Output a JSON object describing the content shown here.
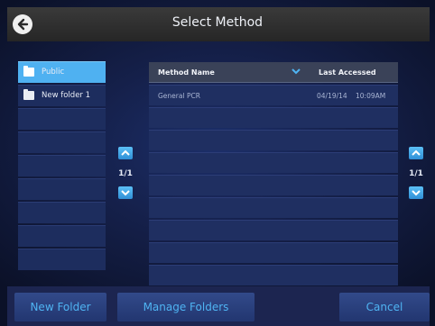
{
  "header": {
    "title": "Select Method"
  },
  "folders": [
    {
      "label": "Public",
      "selected": true
    },
    {
      "label": "New folder 1",
      "selected": false
    }
  ],
  "folder_pager": {
    "page_text": "1/1"
  },
  "method_pager": {
    "page_text": "1/1"
  },
  "table": {
    "columns": [
      "Method Name",
      "Last Accessed"
    ],
    "rows": [
      {
        "name": "General PCR",
        "date": "04/19/14",
        "time": "10:09AM"
      }
    ]
  },
  "footer": {
    "new_folder_label": "New Folder",
    "manage_folders_label": "Manage Folders",
    "cancel_label": "Cancel"
  },
  "colors": {
    "accent": "#4fb1f1",
    "button_text": "#4fb4f3"
  }
}
